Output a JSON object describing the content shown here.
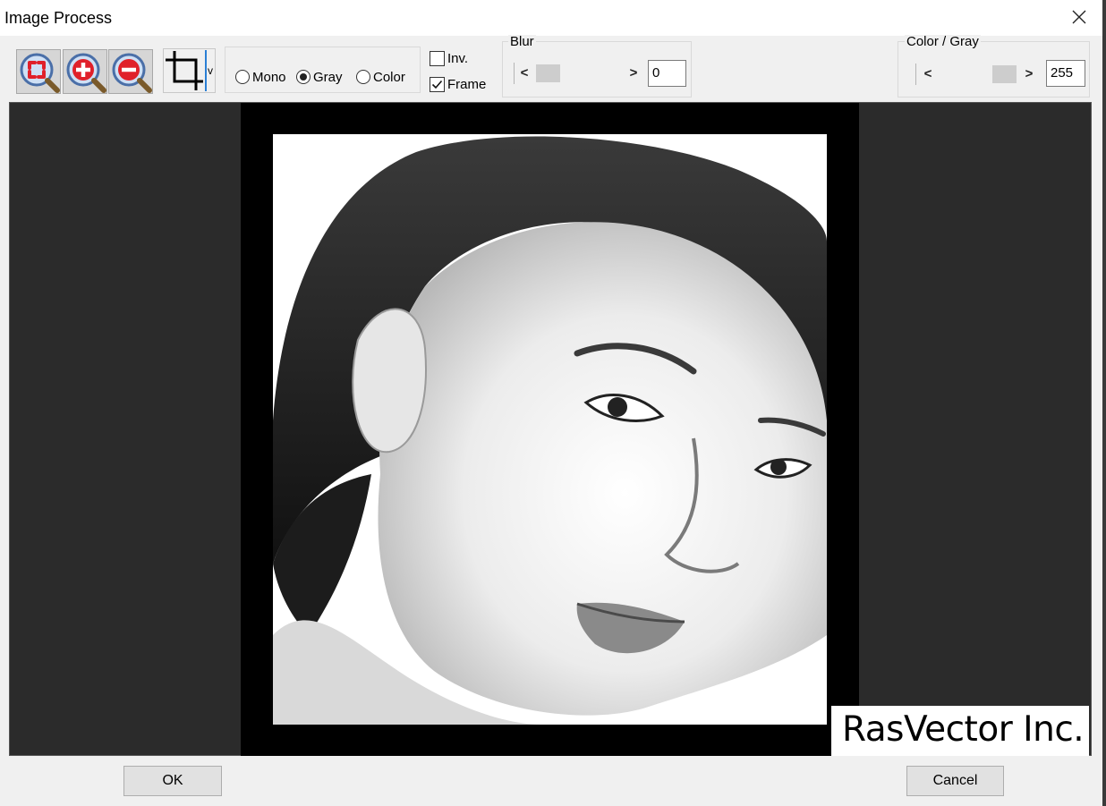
{
  "window": {
    "title": "Image Process"
  },
  "icons": {
    "close": "close-icon",
    "zoom_fit": "zoom-fit-icon",
    "zoom_in": "zoom-in-icon",
    "zoom_out": "zoom-out-icon",
    "crop": "crop-icon",
    "crop_dropdown": "v"
  },
  "colors": {
    "zoom_icon_red": "#e0202a",
    "preview_background": "#2b2b2b",
    "frame": "#000000"
  },
  "mode": {
    "options": [
      {
        "label": "Mono",
        "selected": false
      },
      {
        "label": "Gray",
        "selected": true
      },
      {
        "label": "Color",
        "selected": false
      }
    ]
  },
  "checkboxes": {
    "inv": {
      "label": "Inv.",
      "checked": false
    },
    "frame": {
      "label": "Frame",
      "checked": true
    }
  },
  "blur": {
    "label": "Blur",
    "value": "0",
    "left_arrow": "<",
    "right_arrow": ">"
  },
  "color_gray": {
    "label": "Color / Gray",
    "value": "255",
    "left_arrow": "<",
    "right_arrow": ">"
  },
  "preview": {
    "watermark": "RasVector Inc."
  },
  "buttons": {
    "ok": "OK",
    "cancel": "Cancel"
  }
}
